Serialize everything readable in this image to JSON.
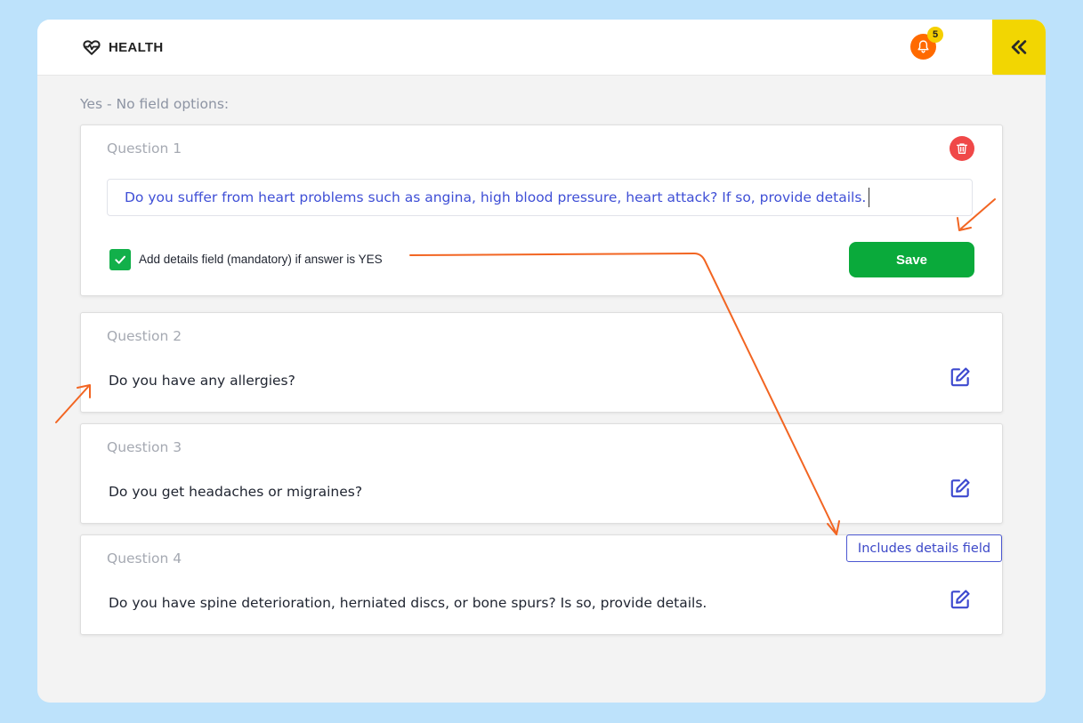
{
  "header": {
    "title": "HEALTH",
    "brand_icon": "heartbeat-icon",
    "notifications_count": "5",
    "bell_icon": "bell-icon",
    "collapse_icon": "double-chevron-left-icon"
  },
  "section_title": "Yes - No field options:",
  "editing": {
    "label": "Question 1",
    "value": "Do you suffer from heart problems such as angina, high blood pressure, heart attack? If so, provide details.",
    "delete_icon": "trash-icon",
    "checkbox_checked": true,
    "checkbox_label": "Add details field (mandatory) if answer is YES",
    "save_label": "Save"
  },
  "questions": [
    {
      "label": "Question 2",
      "text": "Do you have any allergies?",
      "edit_icon": "edit-icon"
    },
    {
      "label": "Question 3",
      "text": "Do you get headaches or migraines?",
      "edit_icon": "edit-icon"
    },
    {
      "label": "Question 4",
      "text": "Do you have spine deterioration, herniated discs, or bone spurs? Is so, provide details.",
      "edit_icon": "edit-icon"
    }
  ],
  "includes_tag": "Includes details field",
  "colors": {
    "page_bg": "#bde2fb",
    "accent_orange": "#ff6a00",
    "save_green": "#0aaa3b",
    "collapse_yellow": "#f2d602",
    "delete_red": "#f04848",
    "link_blue": "#3f4fd6",
    "annotation_orange": "#f26522"
  }
}
